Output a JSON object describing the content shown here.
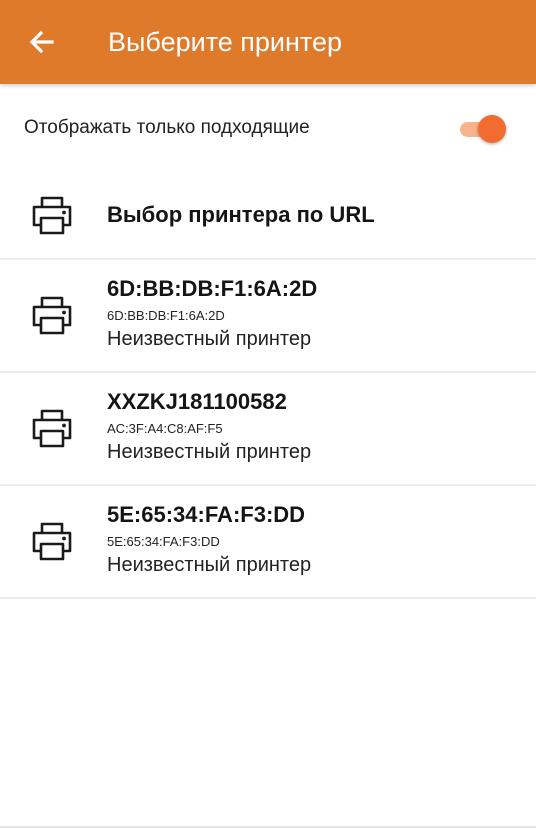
{
  "appbar": {
    "title": "Выберите принтер",
    "color": "#e07a2b"
  },
  "filter": {
    "label": "Отображать только подходящие",
    "enabled": true,
    "accent_color": "#f26b2f"
  },
  "url_option": {
    "label": "Выбор принтера по URL",
    "icon": "printer-icon"
  },
  "printers": [
    {
      "name": "6D:BB:DB:F1:6A:2D",
      "address": "6D:BB:DB:F1:6A:2D",
      "status": "Неизвестный принтер",
      "icon": "printer-icon"
    },
    {
      "name": "XXZKJ181100582",
      "address": "AC:3F:A4:C8:AF:F5",
      "status": "Неизвестный принтер",
      "icon": "printer-icon"
    },
    {
      "name": "5E:65:34:FA:F3:DD",
      "address": "5E:65:34:FA:F3:DD",
      "status": "Неизвестный принтер",
      "icon": "printer-icon"
    }
  ]
}
